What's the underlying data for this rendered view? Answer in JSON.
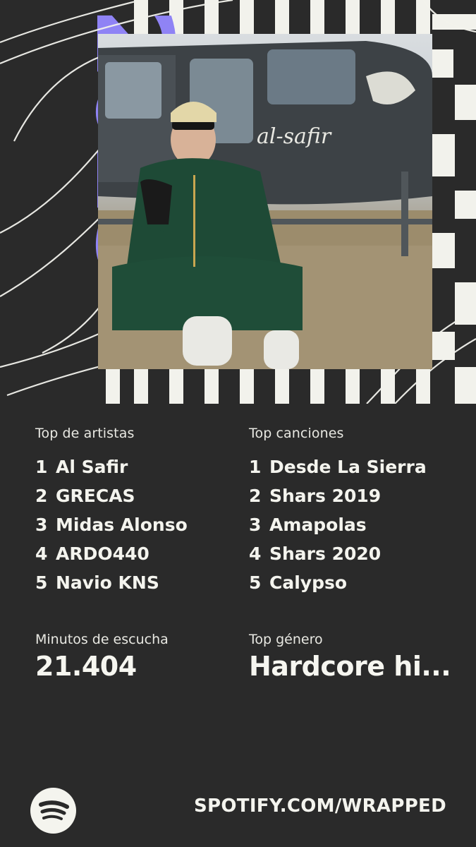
{
  "year_art": "2025",
  "photo_text": "al-safir",
  "top_artists": {
    "heading": "Top de artistas",
    "items": [
      {
        "rank": "1",
        "name": "Al Safir"
      },
      {
        "rank": "2",
        "name": "GRECAS"
      },
      {
        "rank": "3",
        "name": "Midas Alonso"
      },
      {
        "rank": "4",
        "name": "ARDO440"
      },
      {
        "rank": "5",
        "name": "Navio KNS"
      }
    ]
  },
  "top_songs": {
    "heading": "Top canciones",
    "items": [
      {
        "rank": "1",
        "name": "Desde La Sierra"
      },
      {
        "rank": "2",
        "name": "Shars 2019"
      },
      {
        "rank": "3",
        "name": "Amapolas"
      },
      {
        "rank": "4",
        "name": "Shars 2020"
      },
      {
        "rank": "5",
        "name": "Calypso"
      }
    ]
  },
  "minutes": {
    "label": "Minutos de escucha",
    "value": "21.404"
  },
  "genre": {
    "label": "Top género",
    "value": "Hardcore hi..."
  },
  "footer": {
    "logo_icon": "spotify-logo-icon",
    "url": "SPOTIFY.COM/WRAPPED"
  },
  "colors": {
    "background": "#2a2a2a",
    "accent_purple": "#8f83f5",
    "stripe_white": "#f2f2ec",
    "text": "#f4f4ee"
  }
}
